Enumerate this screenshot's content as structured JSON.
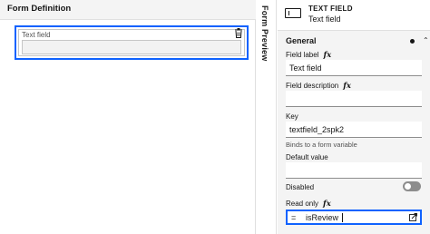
{
  "canvas": {
    "title": "Form Definition",
    "field": {
      "label": "Text field"
    }
  },
  "preview": {
    "label": "Form Preview"
  },
  "properties": {
    "component_type": "TEXT FIELD",
    "component_name": "Text field",
    "section": "General",
    "field_label": {
      "label": "Field label",
      "fx": "fx",
      "value": "Text field"
    },
    "field_description": {
      "label": "Field description",
      "fx": "fx",
      "value": ""
    },
    "key": {
      "label": "Key",
      "value": "textfield_2spk2",
      "helper": "Binds to a form variable"
    },
    "default_value": {
      "label": "Default value",
      "value": ""
    },
    "disabled": {
      "label": "Disabled",
      "on": false
    },
    "read_only": {
      "label": "Read only",
      "fx": "fx",
      "prefix": "=",
      "value": "isReview"
    }
  },
  "colors": {
    "accent": "#0f62fe",
    "panel_bg": "#f4f4f4"
  }
}
